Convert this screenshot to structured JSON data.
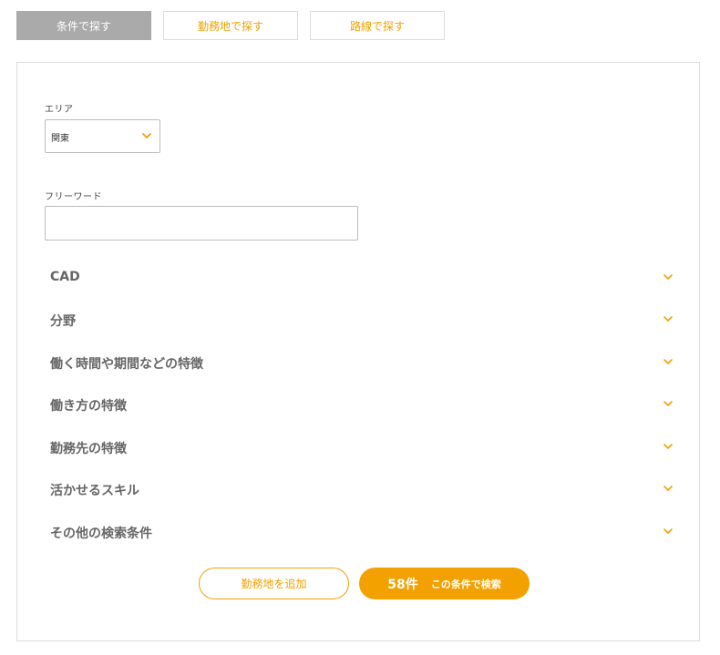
{
  "tabs": [
    {
      "label": "条件で探す",
      "active": true
    },
    {
      "label": "勤務地で探す",
      "active": false
    },
    {
      "label": "路線で探す",
      "active": false
    }
  ],
  "area": {
    "label": "エリア",
    "selected": "関東"
  },
  "freeword": {
    "label": "フリーワード",
    "value": "",
    "placeholder": ""
  },
  "accordion": [
    {
      "label": "CAD",
      "icon": "chevron-down-icon"
    },
    {
      "label": "分野",
      "icon": "chevron-down-icon"
    },
    {
      "label": "働く時間や期間などの特徴",
      "icon": "chevron-down-icon"
    },
    {
      "label": "働き方の特徴",
      "icon": "chevron-down-icon"
    },
    {
      "label": "勤務先の特徴",
      "icon": "chevron-down-icon"
    },
    {
      "label": "活かせるスキル",
      "icon": "chevron-down-icon"
    },
    {
      "label": "その他の検索条件",
      "icon": "chevron-down-icon"
    }
  ],
  "buttons": {
    "add_location": "勤務地を追加",
    "result_count": "58件",
    "search": "この条件で検索"
  },
  "colors": {
    "accent": "#f3a100",
    "active_tab": "#aaaaaa",
    "border": "#dedede",
    "text": "#666666"
  }
}
